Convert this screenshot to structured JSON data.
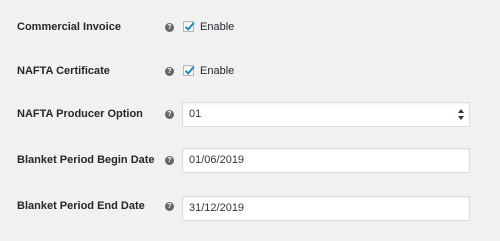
{
  "settings": [
    {
      "label": "Commercial Invoice",
      "type": "checkbox",
      "checked": true,
      "text": "Enable"
    },
    {
      "label": "NAFTA Certificate",
      "type": "checkbox",
      "checked": true,
      "text": "Enable"
    },
    {
      "label": "NAFTA Producer Option",
      "type": "select",
      "value": "01"
    },
    {
      "label": "Blanket Period Begin Date",
      "type": "text",
      "value": "01/06/2019"
    },
    {
      "label": "Blanket Period End Date",
      "type": "text",
      "value": "31/12/2019"
    }
  ],
  "help_icon": "question-mark-circle-icon",
  "accent_color": "#1e8cbe"
}
